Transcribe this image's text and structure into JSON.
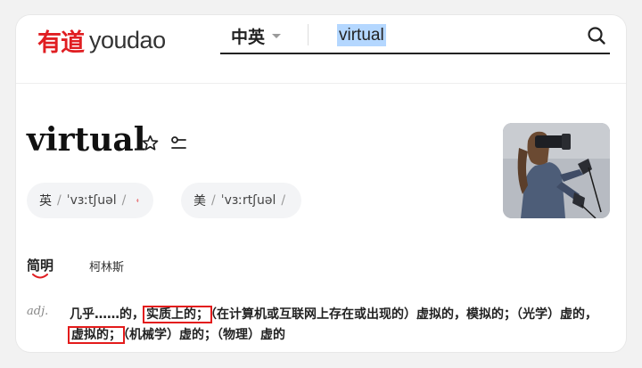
{
  "header": {
    "logo_cn": "有道",
    "logo_en": "youdao",
    "language": "中英",
    "search_value": "virtual"
  },
  "entry": {
    "word": "virtual",
    "pronunciations": [
      {
        "region": "英",
        "ipa": "ˈvɜːtʃuəl"
      },
      {
        "region": "美",
        "ipa": "ˈvɜːrtʃuəl"
      }
    ]
  },
  "tabs": [
    "简明",
    "柯林斯"
  ],
  "definition": {
    "pos": "adj.",
    "segments": [
      {
        "text": "几乎……的，",
        "boxed": false
      },
      {
        "text": "实质上的；",
        "boxed": true
      },
      {
        "text": "（在计算机或互联网上存在或出现的）虚拟的，模拟的；（光学）虚的，",
        "boxed": false
      },
      {
        "text": "虚拟的；",
        "boxed": true
      },
      {
        "text": "（机械学）虚的；（物理）虚的",
        "boxed": false
      }
    ]
  },
  "colors": {
    "brand": "#e01e22",
    "highlight_box": "#e31b1b",
    "selection": "#b4d7ff"
  }
}
